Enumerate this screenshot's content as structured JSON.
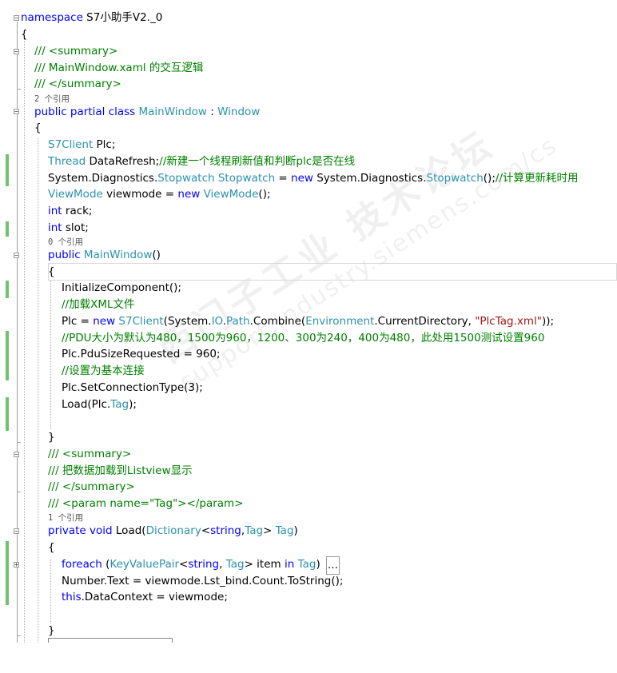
{
  "lines": {
    "ns": "namespace S7小助手V2._0",
    "ob1": "{",
    "sum1": "/// <summary>",
    "sum2": "/// MainWindow.xaml 的交互逻辑",
    "sum3": "/// </summary>",
    "ref1": "2 个引用",
    "cls": "public partial class MainWindow : Window",
    "ob2": "{",
    "f1": "S7Client Plc;",
    "f2": "Thread DataRefresh;//新建一个线程刷新值和判断plc是否在线",
    "f3": "System.Diagnostics.Stopwatch Stopwatch = new System.Diagnostics.Stopwatch();//计算更新耗时用",
    "f4": "ViewMode viewmode = new ViewMode();",
    "f5": "int rack;",
    "f6": "int slot;",
    "ref2": "0 个引用",
    "ctor": "public MainWindow()",
    "ob3": "{",
    "c1": "InitializeComponent();",
    "c2": "//加载XML文件",
    "c3": "Plc = new S7Client(System.IO.Path.Combine(Environment.CurrentDirectory, \"PlcTag.xml\"));",
    "c4": "//PDU大小为默认为480，1500为960，1200、300为240，400为480，此处用1500测试设置960",
    "c5": "Plc.PduSizeRequested = 960;",
    "c6": "//设置为基本连接",
    "c7": "Plc.SetConnectionType(3);",
    "c8": "Load(Plc.Tag);",
    "cb3": "}",
    "s1": "/// <summary>",
    "s2": "/// 把数据加载到Listview显示",
    "s3": "/// </summary>",
    "s4": "/// <param name=\"Tag\"></param>",
    "ref3": "1 个引用",
    "load": "private void Load(Dictionary<string,Tag> Tag)",
    "ob4": "{",
    "l1": "foreach (KeyValuePair<string, Tag> item in Tag)",
    "l1_collapsed": "...",
    "l2": "Number.Text = viewmode.Lst_bind.Count.ToString();",
    "l3": "this.DataContext = viewmode;",
    "cb4": "}"
  },
  "watermark": {
    "line1": "西门子工业  技术论坛",
    "line2": "support.industry.siemens.com/cs"
  },
  "colors": {
    "keyword": "#0000ff",
    "type": "#2b91af",
    "comment": "#008000",
    "string": "#a31515",
    "change_bar": "#6cc46c"
  }
}
